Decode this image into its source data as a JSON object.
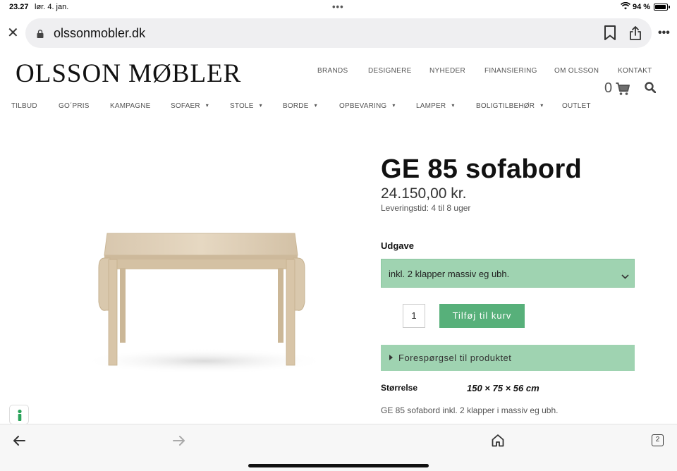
{
  "status_bar": {
    "time": "23.27",
    "date": "lør. 4. jan.",
    "battery_pct": "94 %"
  },
  "browser": {
    "url": "olssonmobler.dk",
    "open_tabs": "2"
  },
  "site": {
    "logo": "OLSSON MØBLER",
    "top_nav": [
      "BRANDS",
      "DESIGNERE",
      "NYHEDER",
      "FINANSIERING",
      "OM OLSSON",
      "KONTAKT"
    ],
    "cart_count": "0",
    "main_nav": [
      "TILBUD",
      "GO´PRIS",
      "KAMPAGNE",
      "SOFAER",
      "STOLE",
      "BORDE",
      "OPBEVARING",
      "LAMPER",
      "BOLIGTILBEHØR",
      "OUTLET"
    ]
  },
  "product": {
    "title": "GE 85 sofabord",
    "price": "24.150,00 kr.",
    "delivery": "Leveringstid: 4 til 8 uger",
    "variant_label": "Udgave",
    "variant_value": "inkl. 2 klapper massiv eg ubh.",
    "quantity": "1",
    "add_to_cart": "Tilføj til kurv",
    "inquiry": "Forespørgsel til produktet",
    "size_label": "Størrelse",
    "size_value": "150 × 75 × 56 cm",
    "description": "GE 85 sofabord inkl. 2 klapper i massiv eg ubh."
  },
  "colors": {
    "accent_green": "#57b07a",
    "light_green": "#9fd3b1"
  }
}
